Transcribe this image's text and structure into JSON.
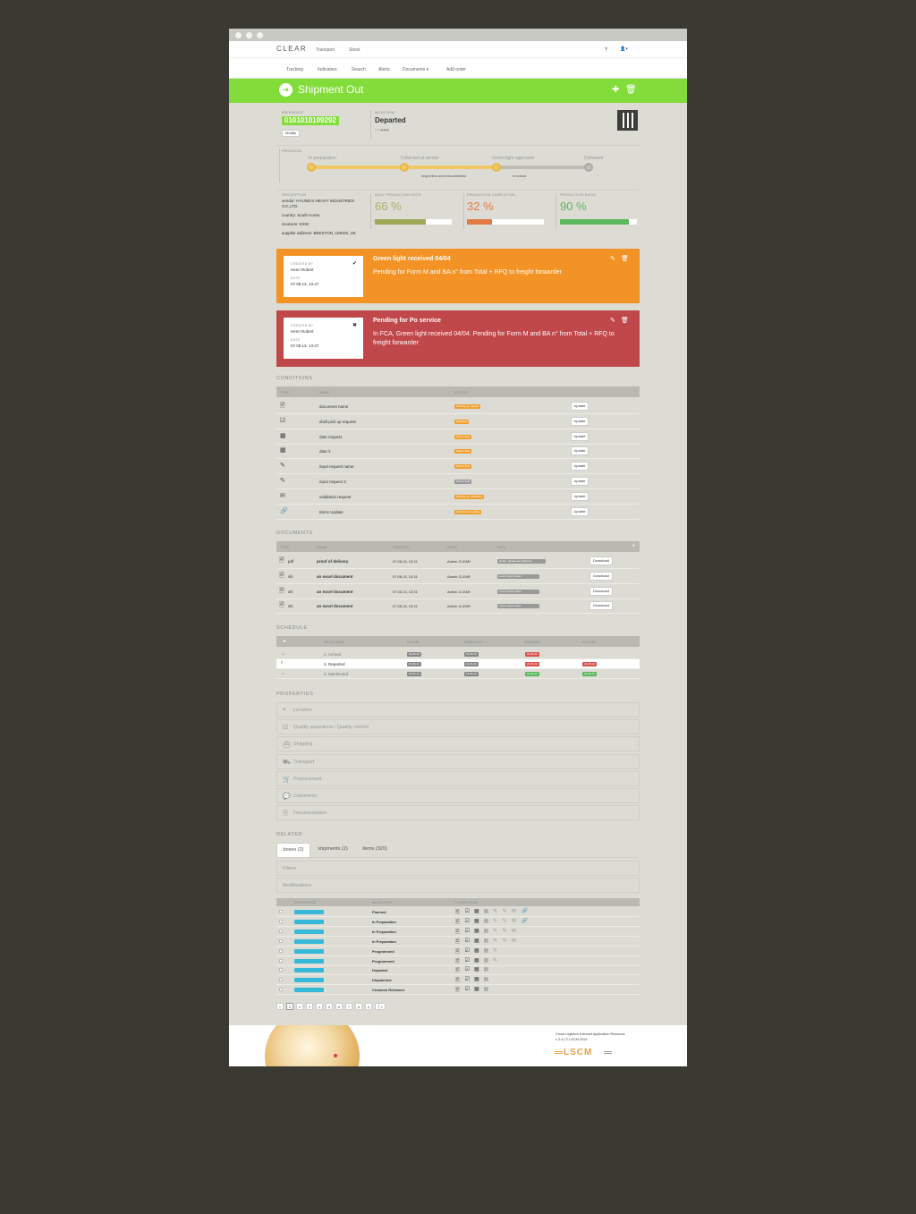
{
  "app": {
    "logo": "CLEAR",
    "top_nav": [
      "Transport",
      "Stock"
    ],
    "sub_nav": [
      "Tracking",
      "Indicators",
      "Search",
      "Alerts",
      "Documents ▾",
      "Add order"
    ],
    "help_icon": "?",
    "user_icon": "▾"
  },
  "page": {
    "title": "Shipment Out"
  },
  "shipment": {
    "reference_label": "REFERENCE",
    "reference": "0101010109292",
    "modify_label": "Modify",
    "milestone_label": "MILESTONE",
    "milestone": "Departed"
  },
  "progress": {
    "label": "PROGRESS",
    "steps": [
      "In preparation",
      "Collected at vendor",
      "Green light approved",
      "Delivered"
    ],
    "sub_steps": [
      "inspection and consolidation",
      "in transit"
    ],
    "value": 0.67
  },
  "details": {
    "label": "DESCRIPTION",
    "vendor": "vendor: HYUNDAI HEAVY INDUSTRIES CO.,LTD.",
    "country": "country: South Korea",
    "incoterm": "incoterm: EXW",
    "supplier": "supplier address: BEESTON, LEEDS, UK"
  },
  "kpis": [
    {
      "label": "DAILY PRODUCTION RATIO",
      "value": "66 %",
      "fill": 0.66,
      "color": "#a0a858"
    },
    {
      "label": "PRODUCTION COMPLETION",
      "value": "32 %",
      "fill": 0.32,
      "color": "#e07b45"
    },
    {
      "label": "PRODUCTION RATIO",
      "value": "90 %",
      "fill": 0.9,
      "color": "#5cb85c"
    }
  ],
  "alerts": [
    {
      "created_by_label": "CREATED BY",
      "created_by": "Henri Robert",
      "date_label": "DATE",
      "date": "07.08.13, 13:47",
      "status_icon": "✔",
      "title": "Green light received 04/04",
      "body": "Pending for Form M and BA n° from Total + RFQ to freight forwarder",
      "color": "#f39325"
    },
    {
      "created_by_label": "CREATED BY",
      "created_by": "Henri Robert",
      "date_label": "DATE",
      "date": "07.08.13, 13:47",
      "status_icon": "✖",
      "title": "Pending for Po service",
      "body": "In FCA, Green light received 04/04. Pending for Form M and BA n° from Total + RFQ to freight forwarder",
      "color": "#c0474a"
    }
  ],
  "conditions": {
    "title": "CONDITIONS",
    "headers": [
      "TYPE",
      "NAME",
      "STATUS"
    ],
    "update_label": "Update",
    "rows": [
      {
        "icon": "🖹",
        "name": "document name",
        "status": "Pending for upload",
        "color": "#f0a030"
      },
      {
        "icon": "☑",
        "name": "draft pick up request",
        "status": "Validated",
        "color": "#f0a030"
      },
      {
        "icon": "▦",
        "name": "date request",
        "status": "Select date",
        "color": "#f0a030"
      },
      {
        "icon": "▦",
        "name": "date 2",
        "status": "Select date",
        "color": "#f0a030"
      },
      {
        "icon": "✎",
        "name": "input request name",
        "status": "Fill the field",
        "color": "#f0a030"
      },
      {
        "icon": "✎",
        "name": "input request 2",
        "status": "Fill the field",
        "color": "#999"
      },
      {
        "icon": "✉",
        "name": "validation request",
        "status": "Pending for validation",
        "color": "#f0a030"
      },
      {
        "icon": "🔗",
        "name": "Items Update",
        "status": "130 items to update",
        "color": "#f0a030"
      }
    ]
  },
  "documents": {
    "title": "DOCUMENTS",
    "headers": [
      "TYPE",
      "NAME",
      "CREATED",
      "USER",
      "INFO"
    ],
    "add": "+",
    "download_label": "Download",
    "rows": [
      {
        "type": "pdf",
        "name": "proof of delivery",
        "created": "07.08.13, 13:31",
        "user": "Admin CLEAR",
        "info": "Grace, please see attached"
      },
      {
        "type": "xls",
        "name": "an excel document",
        "created": "07.08.13, 13:31",
        "user": "Admin CLEAR",
        "info": "Lorem ipsum dolor"
      },
      {
        "type": "xls",
        "name": "an excel document",
        "created": "07.08.13, 13:31",
        "user": "Admin CLEAR",
        "info": "Lorem ipsum dolor"
      },
      {
        "type": "xls",
        "name": "an excel document",
        "created": "07.08.13, 13:31",
        "user": "Admin CLEAR",
        "info": "Lorem ipsum dolor"
      }
    ]
  },
  "schedule": {
    "title": "SCHEDULE",
    "headers": [
      "MILESTONE",
      "INITIAL",
      "FORECAST",
      "REVISED",
      "ACTUAL"
    ],
    "rows": [
      {
        "name": "2. Arrived",
        "initial": "01.06.13",
        "forecast": "01.06.13",
        "revised": "01.06.13",
        "actual": "",
        "rcolor": "#d9534f"
      },
      {
        "name": "3. Departed",
        "initial": "19.06.13",
        "forecast": "19.06.13",
        "revised": "24.06.13",
        "actual": "24.06.13",
        "rcolor": "#d9534f"
      },
      {
        "name": "4. Manifested",
        "initial": "19.06.13",
        "forecast": "19.06.13",
        "revised": "19.06.13",
        "actual": "19.06.13",
        "rcolor": "#5cb85c"
      }
    ]
  },
  "properties": {
    "title": "PROPERTIES",
    "items": [
      {
        "icon": "⌖",
        "label": "Location"
      },
      {
        "icon": "☑",
        "label": "Quality assurance / Quality control"
      },
      {
        "icon": "⛴",
        "label": "Shipping"
      },
      {
        "icon": "⛟",
        "label": "Transport"
      },
      {
        "icon": "🛒",
        "label": "Procurement"
      },
      {
        "icon": "💬",
        "label": "Comments"
      },
      {
        "icon": "🗎",
        "label": "Documentation"
      }
    ]
  },
  "related": {
    "title": "RELATED",
    "tabs": [
      "boxes (2)",
      "shipments (2)",
      "items (320)"
    ],
    "filters": "Filters",
    "modifications": "Modifications",
    "headers": [
      "REFERENCE",
      "MILESTONE",
      "CONDITIONS"
    ],
    "rows": [
      "Planned",
      "In Preparation",
      "In Preparation",
      "In Preparation",
      "Programmed",
      "Programmed",
      "Departed",
      "Dispatched",
      "Customs Released"
    ]
  },
  "pagination": [
    "«",
    "1",
    "2",
    "3",
    "4",
    "5",
    "6",
    "7",
    "8",
    "9",
    "10",
    "»"
  ],
  "footer": {
    "line1": "Cloud Logistics Extranet Application Resource",
    "line2": "v 2.4 | © LSCM 2014",
    "brand": "LSCM"
  }
}
